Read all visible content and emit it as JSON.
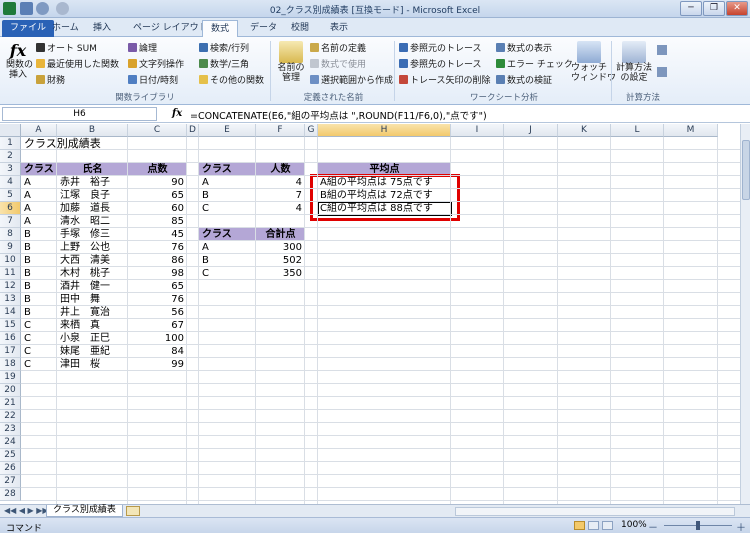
{
  "window": {
    "title": "02_クラス別成績表 [互換モード] - Microsoft Excel",
    "minimize": "─",
    "restore": "❐",
    "close": "✕"
  },
  "tabs": [
    "ファイル",
    "ホーム",
    "挿入",
    "ページ レイアウト",
    "数式",
    "データ",
    "校閲",
    "表示"
  ],
  "ribbon": {
    "insert_function": "関数の\n挿入",
    "fx": "fx",
    "autosum": "オート SUM",
    "recent": "最近使用した関数",
    "finance": "財務",
    "logic": "論理",
    "text": "文字列操作",
    "datetime": "日付/時刻",
    "lookup": "検索/行列",
    "math": "数学/三角",
    "other": "その他の関数",
    "group_library": "関数ライブラリ",
    "name_manager": "名前の\n管理",
    "define_name": "名前の定義",
    "use_in_formula": "数式で使用",
    "create_from_sel": "選択範囲から作成",
    "group_names": "定義された名前",
    "trace_prec": "参照元のトレース",
    "trace_dep": "参照先のトレース",
    "remove_arrows": "トレース矢印の削除",
    "show_formulas": "数式の表示",
    "error_check": "エラー チェック",
    "evaluate": "数式の検証",
    "watch": "ウォッチ\nウィンドウ",
    "group_audit": "ワークシート分析",
    "calc_options": "計算方法\nの設定",
    "group_calc": "計算方法"
  },
  "formula_bar": {
    "name_box": "H6",
    "fx": "fx",
    "formula": "=CONCATENATE(E6,\"組の平均点は \",ROUND(F11/F6,0),\"点です\")"
  },
  "columns": [
    "A",
    "B",
    "C",
    "D",
    "E",
    "F",
    "G",
    "H",
    "I",
    "J",
    "K",
    "L",
    "M"
  ],
  "rows": [
    "1",
    "2",
    "3",
    "4",
    "5",
    "6",
    "7",
    "8",
    "9",
    "10",
    "11",
    "12",
    "13",
    "14",
    "15",
    "16",
    "17",
    "18",
    "19",
    "20",
    "21",
    "22",
    "23",
    "24",
    "25",
    "26",
    "27",
    "28"
  ],
  "sheet": {
    "title": "クラス別成績表",
    "hdr_class": "クラス",
    "hdr_name": "氏名",
    "hdr_score": "点数",
    "students": [
      {
        "cls": "A",
        "name": "赤井　裕子",
        "score": "90"
      },
      {
        "cls": "A",
        "name": "江塚　良子",
        "score": "65"
      },
      {
        "cls": "A",
        "name": "加藤　道長",
        "score": "60"
      },
      {
        "cls": "A",
        "name": "清水　昭二",
        "score": "85"
      },
      {
        "cls": "B",
        "name": "手塚　修三",
        "score": "45"
      },
      {
        "cls": "B",
        "name": "上野　公也",
        "score": "76"
      },
      {
        "cls": "B",
        "name": "大西　清美",
        "score": "86"
      },
      {
        "cls": "B",
        "name": "木村　桃子",
        "score": "98"
      },
      {
        "cls": "B",
        "name": "酒井　健一",
        "score": "65"
      },
      {
        "cls": "B",
        "name": "田中　舞",
        "score": "76"
      },
      {
        "cls": "B",
        "name": "井上　寛治",
        "score": "56"
      },
      {
        "cls": "C",
        "name": "来栖　真",
        "score": "67"
      },
      {
        "cls": "C",
        "name": "小泉　正巳",
        "score": "100"
      },
      {
        "cls": "C",
        "name": "妹尾　亜紀",
        "score": "84"
      },
      {
        "cls": "C",
        "name": "津田　桜",
        "score": "99"
      }
    ],
    "count_hdr_class": "クラス",
    "count_hdr": "人数",
    "counts": [
      {
        "cls": "A",
        "v": "4"
      },
      {
        "cls": "B",
        "v": "7"
      },
      {
        "cls": "C",
        "v": "4"
      }
    ],
    "total_hdr_class": "クラス",
    "total_hdr": "合計点",
    "totals": [
      {
        "cls": "A",
        "v": "300"
      },
      {
        "cls": "B",
        "v": "502"
      },
      {
        "cls": "C",
        "v": "350"
      }
    ],
    "avg_hdr": "平均点",
    "avgs": [
      "A組の平均点は 75点です",
      "B組の平均点は 72点です",
      "C組の平均点は 88点です"
    ]
  },
  "sheet_tab": "クラス別成績表",
  "status": {
    "mode": "コマンド",
    "zoom": "100%",
    "minus": "－",
    "plus": "＋"
  },
  "colors": {
    "header_fill": "#b4a7d6",
    "highlight": "#e00000",
    "ribbon_tab": "#2a62b6"
  }
}
